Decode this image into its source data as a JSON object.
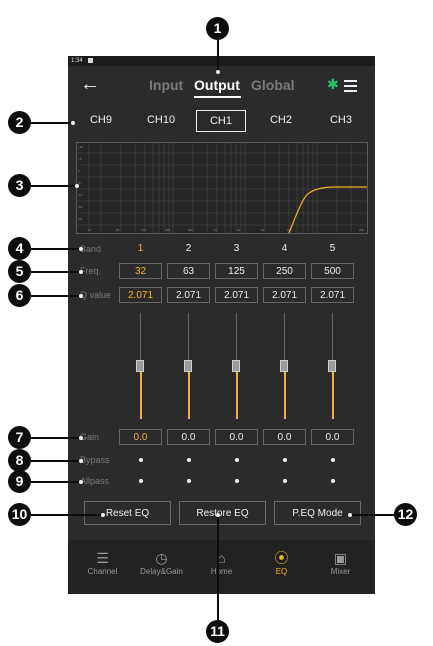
{
  "status": {
    "time": "1:34"
  },
  "topbar": {
    "back_icon": "back-arrow-icon",
    "tabs": [
      "Input",
      "Output",
      "Global"
    ],
    "active_tab": "Output",
    "bluetooth_icon": "bluetooth-icon",
    "menu_icon": "menu-icon"
  },
  "channels": [
    "CH9",
    "CH10",
    "CH1",
    "CH2",
    "CH3"
  ],
  "active_channel": "CH1",
  "graph": {
    "y_ticks": [
      "+12",
      "+6",
      "0",
      "-6",
      "-12",
      "-18",
      "-24"
    ],
    "x_ticks": [
      "20",
      "50",
      "100",
      "200",
      "500",
      "1k",
      "2k",
      "5k",
      "10k",
      "20k"
    ]
  },
  "labels": {
    "band": "Band",
    "freq": "Freq.",
    "q": "Q value",
    "gain": "Gain",
    "bypass": "Bypass",
    "allpass": "Allpass"
  },
  "bands": [
    "1",
    "2",
    "3",
    "4",
    "5"
  ],
  "freqs": [
    "32",
    "63",
    "125",
    "250",
    "500"
  ],
  "q_values": [
    "2.071",
    "2.071",
    "2.071",
    "2.071",
    "2.071"
  ],
  "gains": [
    "0.0",
    "0.0",
    "0.0",
    "0.0",
    "0.0"
  ],
  "gain_levels": [
    0.5,
    0.5,
    0.5,
    0.5,
    0.5
  ],
  "buttons": {
    "reset": "Reset EQ",
    "restore": "Restore EQ",
    "peq": "P.EQ Mode"
  },
  "nav": [
    {
      "label": "Channel",
      "icon": "list-icon"
    },
    {
      "label": "Delay&Gain",
      "icon": "timer-icon"
    },
    {
      "label": "Home",
      "icon": "home-icon"
    },
    {
      "label": "EQ",
      "icon": "eq-icon"
    },
    {
      "label": "Mixer",
      "icon": "mixer-icon"
    }
  ],
  "active_nav": "EQ",
  "callouts": [
    "1",
    "2",
    "3",
    "4",
    "5",
    "6",
    "7",
    "8",
    "9",
    "10",
    "11",
    "12"
  ],
  "colors": {
    "accent": "#f0b429",
    "bluetooth": "#27c46a",
    "background": "#2b2b2b"
  }
}
